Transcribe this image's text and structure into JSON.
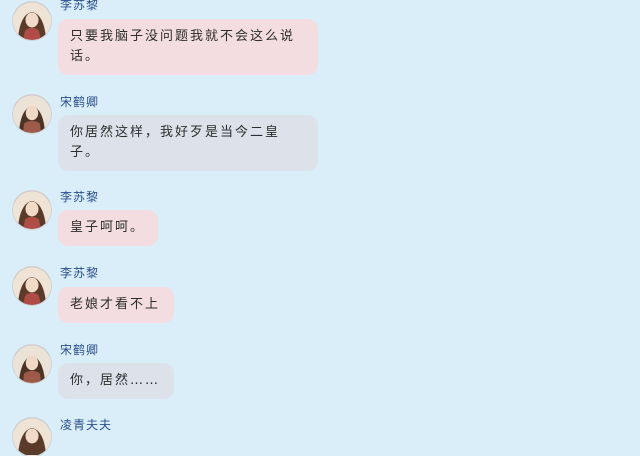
{
  "conversation": [
    {
      "sender": "李苏黎",
      "text": "只要我脑子没问题我就不会这么说话。",
      "bubble_color": "#f3dde0"
    },
    {
      "sender": "宋鹤卿",
      "text": "你居然这样，我好歹是当今二皇子。",
      "bubble_color": "#dde2ea"
    },
    {
      "sender": "李苏黎",
      "text": "皇子呵呵。",
      "bubble_color": "#f3dde0"
    },
    {
      "sender": "李苏黎",
      "text": "老娘才看不上",
      "bubble_color": "#f3dde0"
    },
    {
      "sender": "宋鹤卿",
      "text": "你，居然……",
      "bubble_color": "#dde2ea"
    },
    {
      "sender": "凌青夫夫",
      "text": "",
      "bubble_color": "#f3dde0"
    }
  ],
  "colors": {
    "background": "#daeef9",
    "name_text": "#2a4f8a",
    "message_text": "#2d2d2d"
  }
}
